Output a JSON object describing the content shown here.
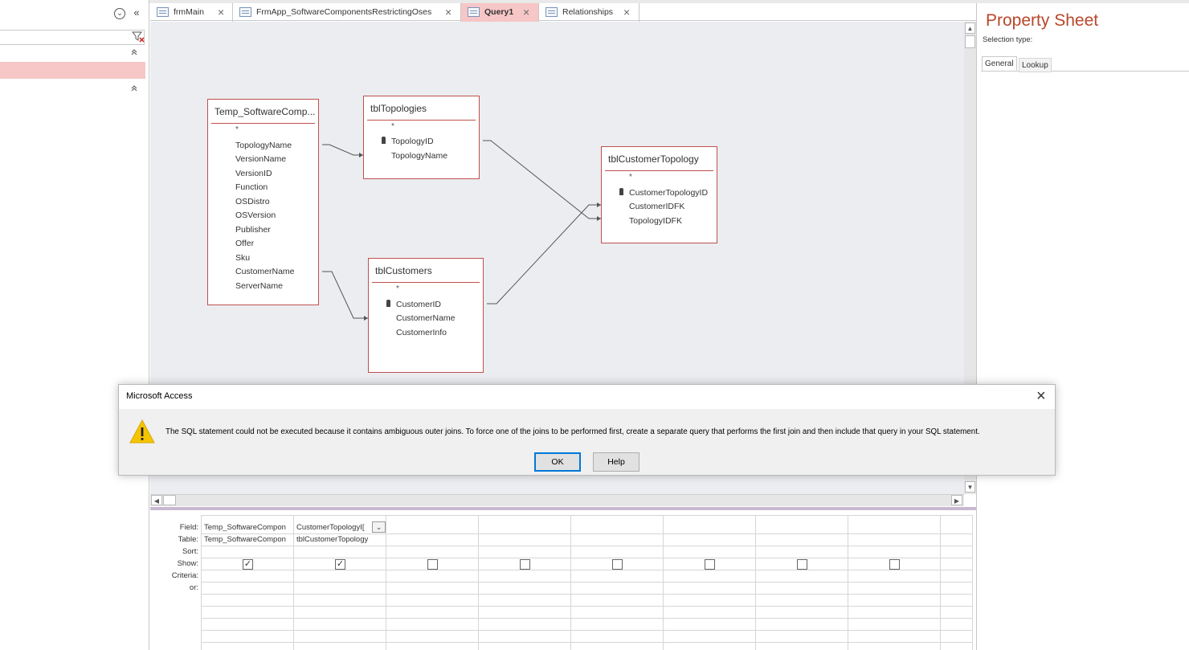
{
  "nav_pane": {
    "collapse_label": "«",
    "dropdown_label": "⌄",
    "filter_clear_label": "⧩",
    "group_collapse_1": "˄",
    "group_collapse_2": "˄"
  },
  "tabs": [
    {
      "label": "frmMain",
      "close": "×"
    },
    {
      "label": "FrmApp_SoftwareComponentsRestrictingOses",
      "close": "×"
    },
    {
      "label": "Query1",
      "close": "×"
    },
    {
      "label": "Relationships",
      "close": "×"
    }
  ],
  "tables": {
    "temp": {
      "title": "Temp_SoftwareComp...",
      "star": "*",
      "fields": [
        "TopologyName",
        "VersionName",
        "VersionID",
        "Function",
        "OSDistro",
        "OSVersion",
        "Publisher",
        "Offer",
        "Sku",
        "CustomerName",
        "ServerName"
      ]
    },
    "topologies": {
      "title": "tblTopologies",
      "star": "*",
      "fields": [
        "TopologyID",
        "TopologyName"
      ]
    },
    "customer_topology": {
      "title": "tblCustomerTopology",
      "star": "*",
      "fields": [
        "CustomerTopologyID",
        "CustomerIDFK",
        "TopologyIDFK"
      ]
    },
    "customers": {
      "title": "tblCustomers",
      "star": "*",
      "fields": [
        "CustomerID",
        "CustomerName",
        "CustomerInfo"
      ]
    }
  },
  "grid": {
    "row_labels": [
      "Field:",
      "Table:",
      "Sort:",
      "Show:",
      "Criteria:",
      "or:"
    ],
    "columns": [
      {
        "field": "Temp_SoftwareCompon",
        "table": "Temp_SoftwareCompon",
        "show": true
      },
      {
        "field": "CustomerTopologyI[",
        "table": "tblCustomerTopology",
        "show": true
      },
      {
        "field": "",
        "table": "",
        "show": false
      },
      {
        "field": "",
        "table": "",
        "show": false
      },
      {
        "field": "",
        "table": "",
        "show": false
      },
      {
        "field": "",
        "table": "",
        "show": false
      },
      {
        "field": "",
        "table": "",
        "show": false
      },
      {
        "field": "",
        "table": "",
        "show": false
      }
    ],
    "dropdown_arrow": "⌄"
  },
  "property_sheet": {
    "title": "Property Sheet",
    "selection_type": "Selection type:",
    "tabs": [
      "General",
      "Lookup"
    ]
  },
  "dialog": {
    "title": "Microsoft Access",
    "close": "×",
    "message": "The SQL statement could not be executed because it contains ambiguous outer joins. To force one of the joins to be performed first, create a separate query that performs the first join and then include that query in your SQL statement.",
    "ok_label": "OK",
    "help_label": "Help",
    "warning_glyph": "!"
  },
  "colors": {
    "accent": "#c0504d",
    "tab_active": "#f7c6c6",
    "title_red": "#b7472a",
    "warning": "#f5c400"
  }
}
